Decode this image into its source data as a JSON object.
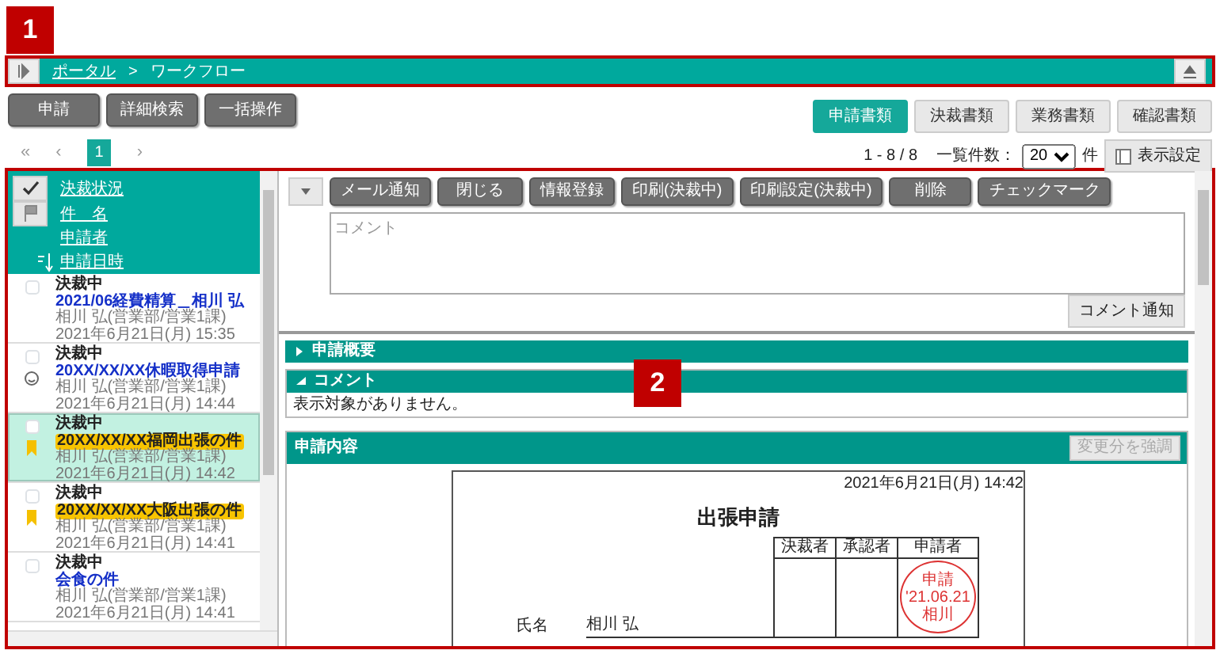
{
  "callouts": [
    {
      "label": "1"
    },
    {
      "label": "2"
    }
  ],
  "header": {
    "breadcrumb": [
      {
        "label": "ポータル",
        "link": true
      },
      {
        "label": "ワークフロー",
        "link": false
      }
    ],
    "separator": ">"
  },
  "actions": [
    "申請",
    "詳細検索",
    "一括操作"
  ],
  "doc_tabs": [
    {
      "label": "申請書類",
      "selected": true
    },
    {
      "label": "決裁書類",
      "selected": false
    },
    {
      "label": "業務書類",
      "selected": false
    },
    {
      "label": "確認書類",
      "selected": false
    }
  ],
  "pager": {
    "first": "«",
    "prev": "‹",
    "pages": [
      {
        "label": "1",
        "selected": true
      }
    ],
    "next": "›"
  },
  "count": "1 - 8 / 8",
  "per_page_label": "一覧件数：",
  "per_page": "20",
  "per_page_unit": "件",
  "display_settings": "表示設定",
  "sort_header": [
    {
      "label": "決裁状況",
      "kind": "check"
    },
    {
      "label": "件　名",
      "kind": "flag"
    },
    {
      "label": "申請者",
      "kind": "none"
    },
    {
      "label": "申請日時",
      "kind": "sort"
    }
  ],
  "items": [
    {
      "status": "決裁中",
      "title": "2021/06経費精算＿相川 弘",
      "applicant": "相川 弘(営業部/営業1課)",
      "datetime": "2021年6月21日(月) 15:35",
      "checked": false,
      "selected": false,
      "kind": "plain"
    },
    {
      "status": "決裁中",
      "title": "20XX/XX/XX休暇取得申請",
      "applicant": "相川 弘(営業部/営業1課)",
      "datetime": "2021年6月21日(月) 14:44",
      "checked": false,
      "selected": false,
      "kind": "smiley"
    },
    {
      "status": "決裁中",
      "title": "20XX/XX/XX福岡出張の件",
      "applicant": "相川 弘(営業部/営業1課)",
      "datetime": "2021年6月21日(月) 14:42",
      "checked": false,
      "selected": true,
      "kind": "bookmark"
    },
    {
      "status": "決裁中",
      "title": "20XX/XX/XX大阪出張の件",
      "applicant": "相川 弘(営業部/営業1課)",
      "datetime": "2021年6月21日(月) 14:41",
      "checked": false,
      "selected": false,
      "kind": "bookmark"
    },
    {
      "status": "決裁中",
      "title": "会食の件",
      "applicant": "相川 弘(営業部/営業1課)",
      "datetime": "2021年6月21日(月) 14:41",
      "checked": false,
      "selected": false,
      "kind": "plain"
    }
  ],
  "detail_toolbar": [
    "メール通知",
    "閉じる",
    "情報登録",
    "印刷(決裁中)",
    "印刷設定(決裁中)",
    "削除",
    "チェックマーク"
  ],
  "comment": {
    "placeholder": "コメント",
    "notify_button": "コメント通知"
  },
  "sections": [
    {
      "title": "申請概要",
      "expanded": false
    },
    {
      "title": "コメント",
      "expanded": true,
      "body": "表示対象がありません。"
    }
  ],
  "content": {
    "title": "申請内容",
    "highlight_button": {
      "label": "変更分を強調",
      "disabled": true
    },
    "document": {
      "date": "2021年6月21日(月) 14:42",
      "title": "出張申請",
      "approval_columns": [
        "決裁者",
        "承認者",
        "申請者"
      ],
      "stamp": [
        "申請",
        "'21.06.21",
        "相川"
      ],
      "name_label": "氏名",
      "name": "相川 弘"
    }
  }
}
